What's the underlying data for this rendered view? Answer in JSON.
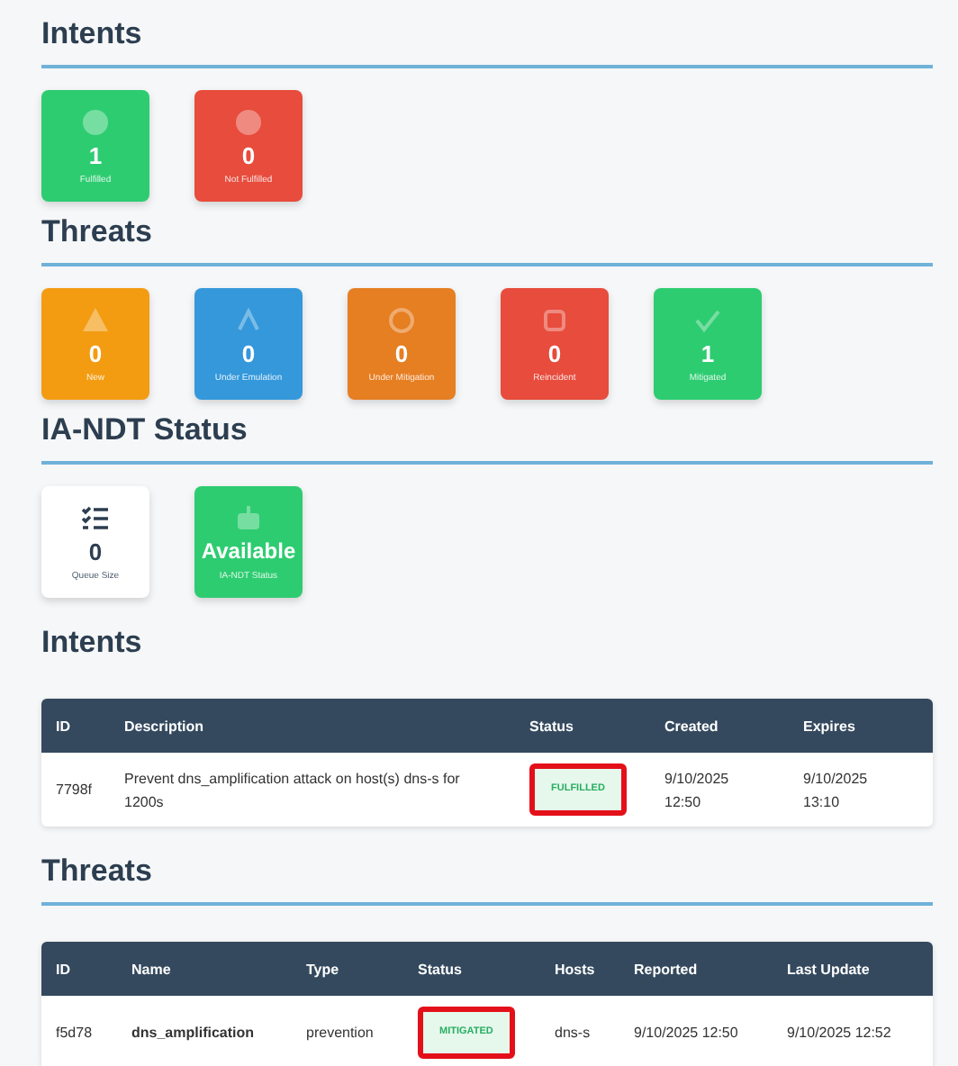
{
  "sections": [
    {
      "kind": "cards",
      "title": "Intents",
      "underlined": true,
      "cards": [
        {
          "kind": "fulfilled",
          "value": "1",
          "label": "Fulfilled",
          "color": "#2ecc71"
        },
        {
          "kind": "failed",
          "value": "0",
          "label": "Not Fulfilled",
          "color": "#e74c3c"
        }
      ]
    },
    {
      "kind": "cards",
      "title": "Threats",
      "underlined": true,
      "cards": [
        {
          "kind": "warning",
          "value": "0",
          "label": "New",
          "color": "#f39c12"
        },
        {
          "kind": "emulation",
          "value": "0",
          "label": "Under Emulation",
          "color": "#3498db"
        },
        {
          "kind": "mitigation",
          "value": "0",
          "label": "Under Mitigation",
          "color": "#e67e22"
        },
        {
          "kind": "reincident",
          "value": "0",
          "label": "Reincident",
          "color": "#e74c3c"
        },
        {
          "kind": "mitigated",
          "value": "1",
          "label": "Mitigated",
          "color": "#2ecc71"
        }
      ]
    },
    {
      "kind": "cards",
      "title": "IA-NDT Status",
      "underlined": true,
      "cards": [
        {
          "kind": "queue",
          "value": "0",
          "label": "Queue Size",
          "color": "#ffffff"
        },
        {
          "kind": "robot",
          "value": "Available",
          "label": "IA-NDT Status",
          "color": "#2ecc71"
        }
      ]
    },
    {
      "kind": "table",
      "title": "Intents",
      "underlined": false,
      "columns": [
        "ID",
        "Description",
        "Status",
        "Created",
        "Expires"
      ],
      "rows": [
        {
          "cells": [
            {
              "kind": "text",
              "text": "7798f"
            },
            {
              "kind": "text",
              "text": "Prevent dns_amplification attack on host(s) dns-s for 1200s"
            },
            {
              "kind": "status",
              "text": "FULFILLED",
              "highlighted": true
            },
            {
              "kind": "text",
              "text": "9/10/2025 12:50"
            },
            {
              "kind": "text",
              "text": "9/10/2025 13:10"
            }
          ]
        }
      ]
    },
    {
      "kind": "table",
      "title": "Threats",
      "underlined": true,
      "columns": [
        "ID",
        "Name",
        "Type",
        "Status",
        "Hosts",
        "Reported",
        "Last Update"
      ],
      "rows": [
        {
          "cells": [
            {
              "kind": "text",
              "text": "f5d78"
            },
            {
              "kind": "bold",
              "text": "dns_amplification"
            },
            {
              "kind": "text",
              "text": "prevention"
            },
            {
              "kind": "status",
              "text": "MITIGATED",
              "highlighted": true
            },
            {
              "kind": "text",
              "text": "dns-s"
            },
            {
              "kind": "text",
              "text": "9/10/2025 12:50"
            },
            {
              "kind": "text",
              "text": "9/10/2025 12:52"
            }
          ]
        }
      ]
    }
  ]
}
